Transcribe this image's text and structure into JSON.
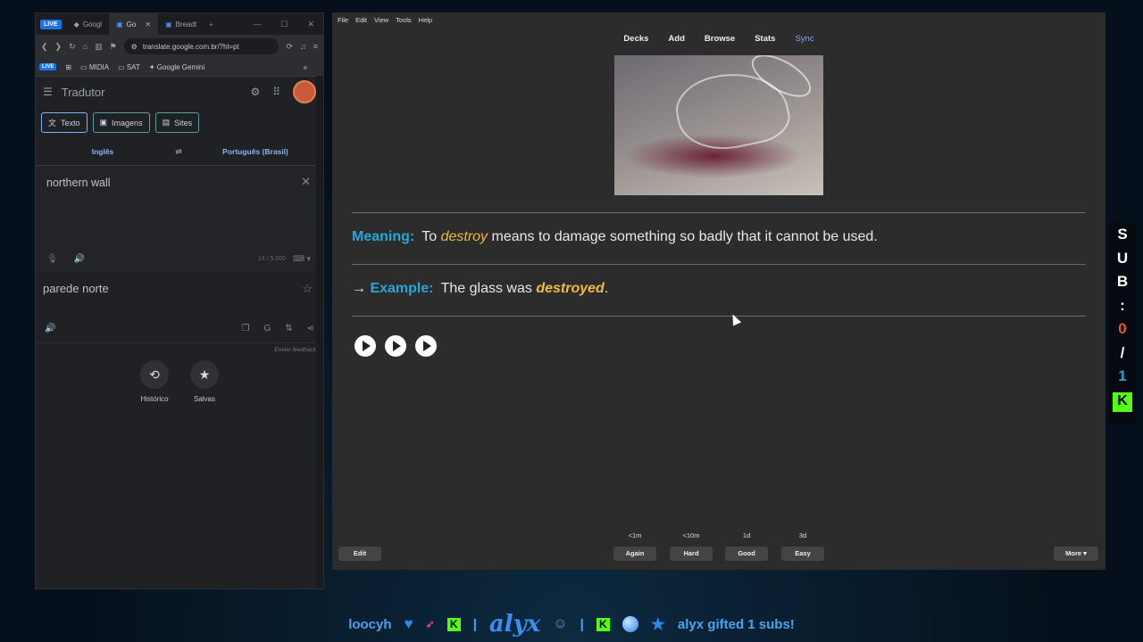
{
  "browser": {
    "live_badge": "LIVE",
    "tabs": [
      {
        "label": "Googl"
      },
      {
        "label": "Go"
      },
      {
        "label": "Breadt"
      }
    ],
    "new_tab": "+",
    "address": "translate.google.com.br/?hl=pt",
    "bookmarks": {
      "live": "LIVE",
      "items": [
        "MIDIA",
        "SAT",
        "Google Gemini"
      ],
      "more": "»"
    }
  },
  "translator": {
    "title": "Tradutor",
    "modes": [
      "Texto",
      "Imagens",
      "Sites"
    ],
    "source_lang": "Inglês",
    "target_lang": "Português (Brasil)",
    "source_text": "northern wall",
    "char_count": "14 / 5.000",
    "translated_text": "parede norte",
    "feedback": "Enviar feedback",
    "history_label": "Histórico",
    "saved_label": "Salvas"
  },
  "anki": {
    "menu": [
      "File",
      "Edit",
      "View",
      "Tools",
      "Help"
    ],
    "toolbar": {
      "decks": "Decks",
      "add": "Add",
      "browse": "Browse",
      "stats": "Stats",
      "sync": "Sync"
    },
    "meaning_label": "Meaning:",
    "meaning_pre": "To",
    "meaning_word": "destroy",
    "meaning_post": "means to damage something so badly that it cannot be used.",
    "example_arrow": "→",
    "example_label": "Example:",
    "example_pre": "The glass was",
    "example_word": "destroyed",
    "example_post": ".",
    "edit_button": "Edit",
    "more_button": "More ▾",
    "answers": [
      {
        "interval": "<1m",
        "label": "Again"
      },
      {
        "interval": "<10m",
        "label": "Hard"
      },
      {
        "interval": "1d",
        "label": "Good"
      },
      {
        "interval": "3d",
        "label": "Easy"
      }
    ]
  },
  "sub_counter": {
    "letters": [
      "S",
      "U",
      "B",
      ":"
    ],
    "current": "0",
    "slash": "/",
    "goal": "1",
    "logo": "K"
  },
  "ticker": {
    "user": "loocyh",
    "sep": "|",
    "brand": "alyx",
    "k": "K",
    "gift_text": "alyx gifted 1 subs!"
  },
  "colors": {
    "accent": "#2ba5d6",
    "keyword": "#f0b844",
    "kick_green": "#53fc18",
    "counter_zero": "#e0582b"
  }
}
